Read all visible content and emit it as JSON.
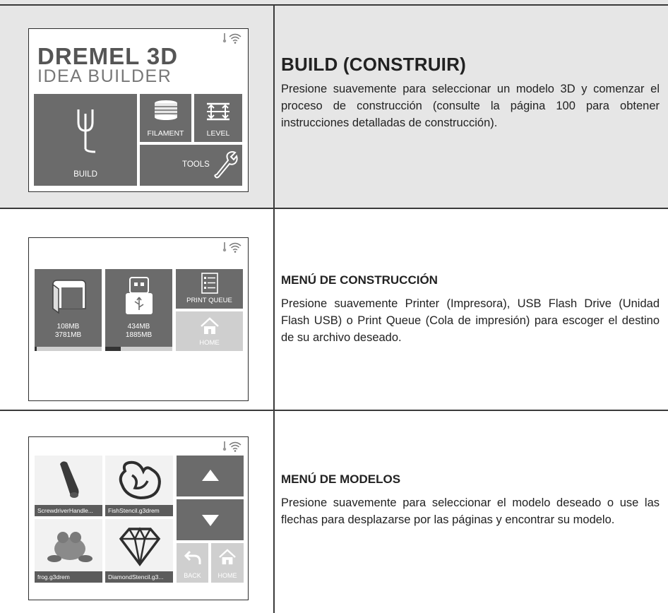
{
  "rows": [
    {
      "title": "BUILD (CONSTRUIR)",
      "body": "Presione suavemente para seleccionar un modelo 3D y comenzar el proceso de construcción (consulte la página 100 para obtener instrucciones detalladas de construcción).",
      "screen": {
        "brand": "DREMEL 3D",
        "brand_sub": "IDEA BUILDER",
        "build_label": "BUILD",
        "filament_label": "FILAMENT",
        "level_label": "LEVEL",
        "tools_label": "TOOLS"
      }
    },
    {
      "title": "MENÚ DE CONSTRUCCIÓN",
      "body": "Presione suavemente Printer (Impresora), USB Flash Drive (Unidad Flash USB) o Print Queue (Cola de impresión) para escoger el destino de su archivo deseado.",
      "screen": {
        "printer_used": "108MB",
        "printer_total": "3781MB",
        "printer_fill": 0.03,
        "usb_used": "434MB",
        "usb_total": "1885MB",
        "usb_fill": 0.23,
        "print_queue_label": "PRINT QUEUE",
        "home_label": "HOME"
      }
    },
    {
      "title": "MENÚ DE MODELOS",
      "body": "Presione suavemente para seleccionar el modelo deseado o use las flechas para desplazarse por las páginas y encontrar su modelo.",
      "screen": {
        "models": [
          "ScrewdriverHandle...",
          "FishStencil.g3drem",
          "frog.g3drem",
          "DiamondStencil.g3..."
        ],
        "back_label": "BACK",
        "home_label": "HOME"
      }
    }
  ],
  "colors": {
    "tile": "#6b6b6b",
    "tile_light": "#cfcfcf",
    "row1_background": "#e6e6e6",
    "lines": "#3a3a3a"
  },
  "icons": [
    "thermometer-icon",
    "wifi-icon",
    "tuning-fork-icon",
    "spool-icon",
    "level-arrows-icon",
    "wrench-icon",
    "printer-icon",
    "usb-drive-icon",
    "list-icon",
    "home-icon",
    "arrow-up-icon",
    "arrow-down-icon",
    "back-arrow-icon"
  ]
}
